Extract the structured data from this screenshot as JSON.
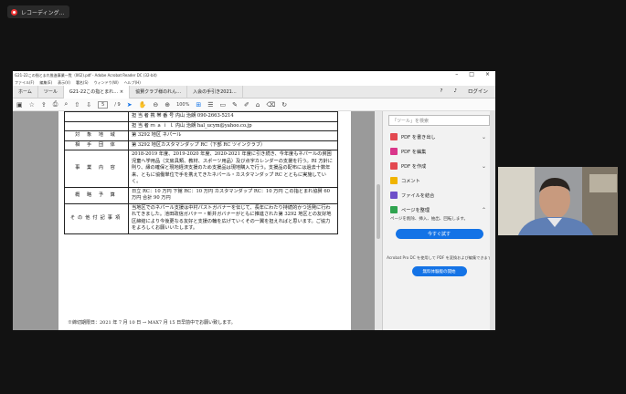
{
  "recording": {
    "label": "レコーディング..."
  },
  "window": {
    "title": "G21-22この指とまれ推進事業一覧（062).pdf - Adobe Acrobat Reader DC (32-bit)",
    "menu": [
      "ファイル(F)",
      "編集(E)",
      "表示(V)",
      "署名(S)",
      "ウィンドウ(W)",
      "ヘルプ(H)"
    ],
    "controls": {
      "minimize": "–",
      "maximize": "□",
      "close": "×"
    }
  },
  "tabs": {
    "home": "ホーム",
    "tools": "ツール",
    "items": [
      "G21-22この指とまれ… ×",
      "協賛クラブ様のれん…",
      "入会の手引き2021…"
    ],
    "signin": "ログイン"
  },
  "toolbar": {
    "page": "5",
    "pages": "/ 9",
    "zoom": "100%"
  },
  "document": {
    "rows": [
      {
        "label": "",
        "value": "担 当 者 携 帯 番 号  内山 治朗 090-2663-5214"
      },
      {
        "label": "",
        "value": "担 当 者 ｍ ａ ｉ ｌ  内山 治朗 hal_ucym@yahoo.co.jp"
      },
      {
        "label": "対 象 地 域",
        "value": "第 3292 地区 ネパール"
      },
      {
        "label": "相 手 団 体",
        "value": "第 3292 地区カスタマンダップ RC（下部 RC ツインクラブ）"
      },
      {
        "label": "事 業 内 容",
        "value": "2018-2019 年度、2019-2020 年度、2020-2021 年度に引き続き、今年度もネパールの貧困児童へ学用品（文房具類、教材、スポーツ用品）及び点字カレンダーの支援を行う。RI 方針に則り、縁の確保と現地経済支援のため支援品は現地購入で行う。支援品の配布には過去十数年来、ともに協働単位で手を携えてきたネパール・カスタマンダップ RC とともに実施していく。"
      },
      {
        "label": "概 略 予 算",
        "value": "日立 RC：10 万円  下館 RC：10 万円  カスタマンダップ RC：10 万円  この指とまれ協賛 60 万円    合計 90 万円"
      },
      {
        "label": "その他付記事項",
        "value": "当地区でのネパール支援は中村パストガバナーを伝じて、長年にわたり持続的かつ活発に行われてきました。池田政信ガバナー・新井ガバナーがともに推進された第 3292 地区との友好地区締結により今後更なる友好と支援の輪を広げていくその一翼を担えればと思います。ご協力をよろしくお願いいたします。"
      }
    ],
    "footer": "※締切期限日：2021 年 7 月 10 日 → MAX7 月 15 日早前中でお願い致します。"
  },
  "right_pane": {
    "search": "「ツール」を検索",
    "items": [
      {
        "label": "PDF を書き出し",
        "color": "#e34850",
        "chevron": true
      },
      {
        "label": "PDF を編集",
        "color": "#d9368a",
        "chevron": false
      },
      {
        "label": "PDF を作成",
        "color": "#e34850",
        "chevron": true
      },
      {
        "label": "コメント",
        "color": "#f0b400",
        "chevron": false
      },
      {
        "label": "ファイルを結合",
        "color": "#6e4fc9",
        "chevron": false
      },
      {
        "label": "ページを整理",
        "color": "#2fa34f",
        "chevron": true
      }
    ],
    "desc": "ページを削除、挿入、抽出、回転します。",
    "try_button": "今すぐ試す",
    "pro_note": "Acrobat Pro DC を使用して PDF を変換および編集できます",
    "trial_button": "無料体験版の開始"
  }
}
